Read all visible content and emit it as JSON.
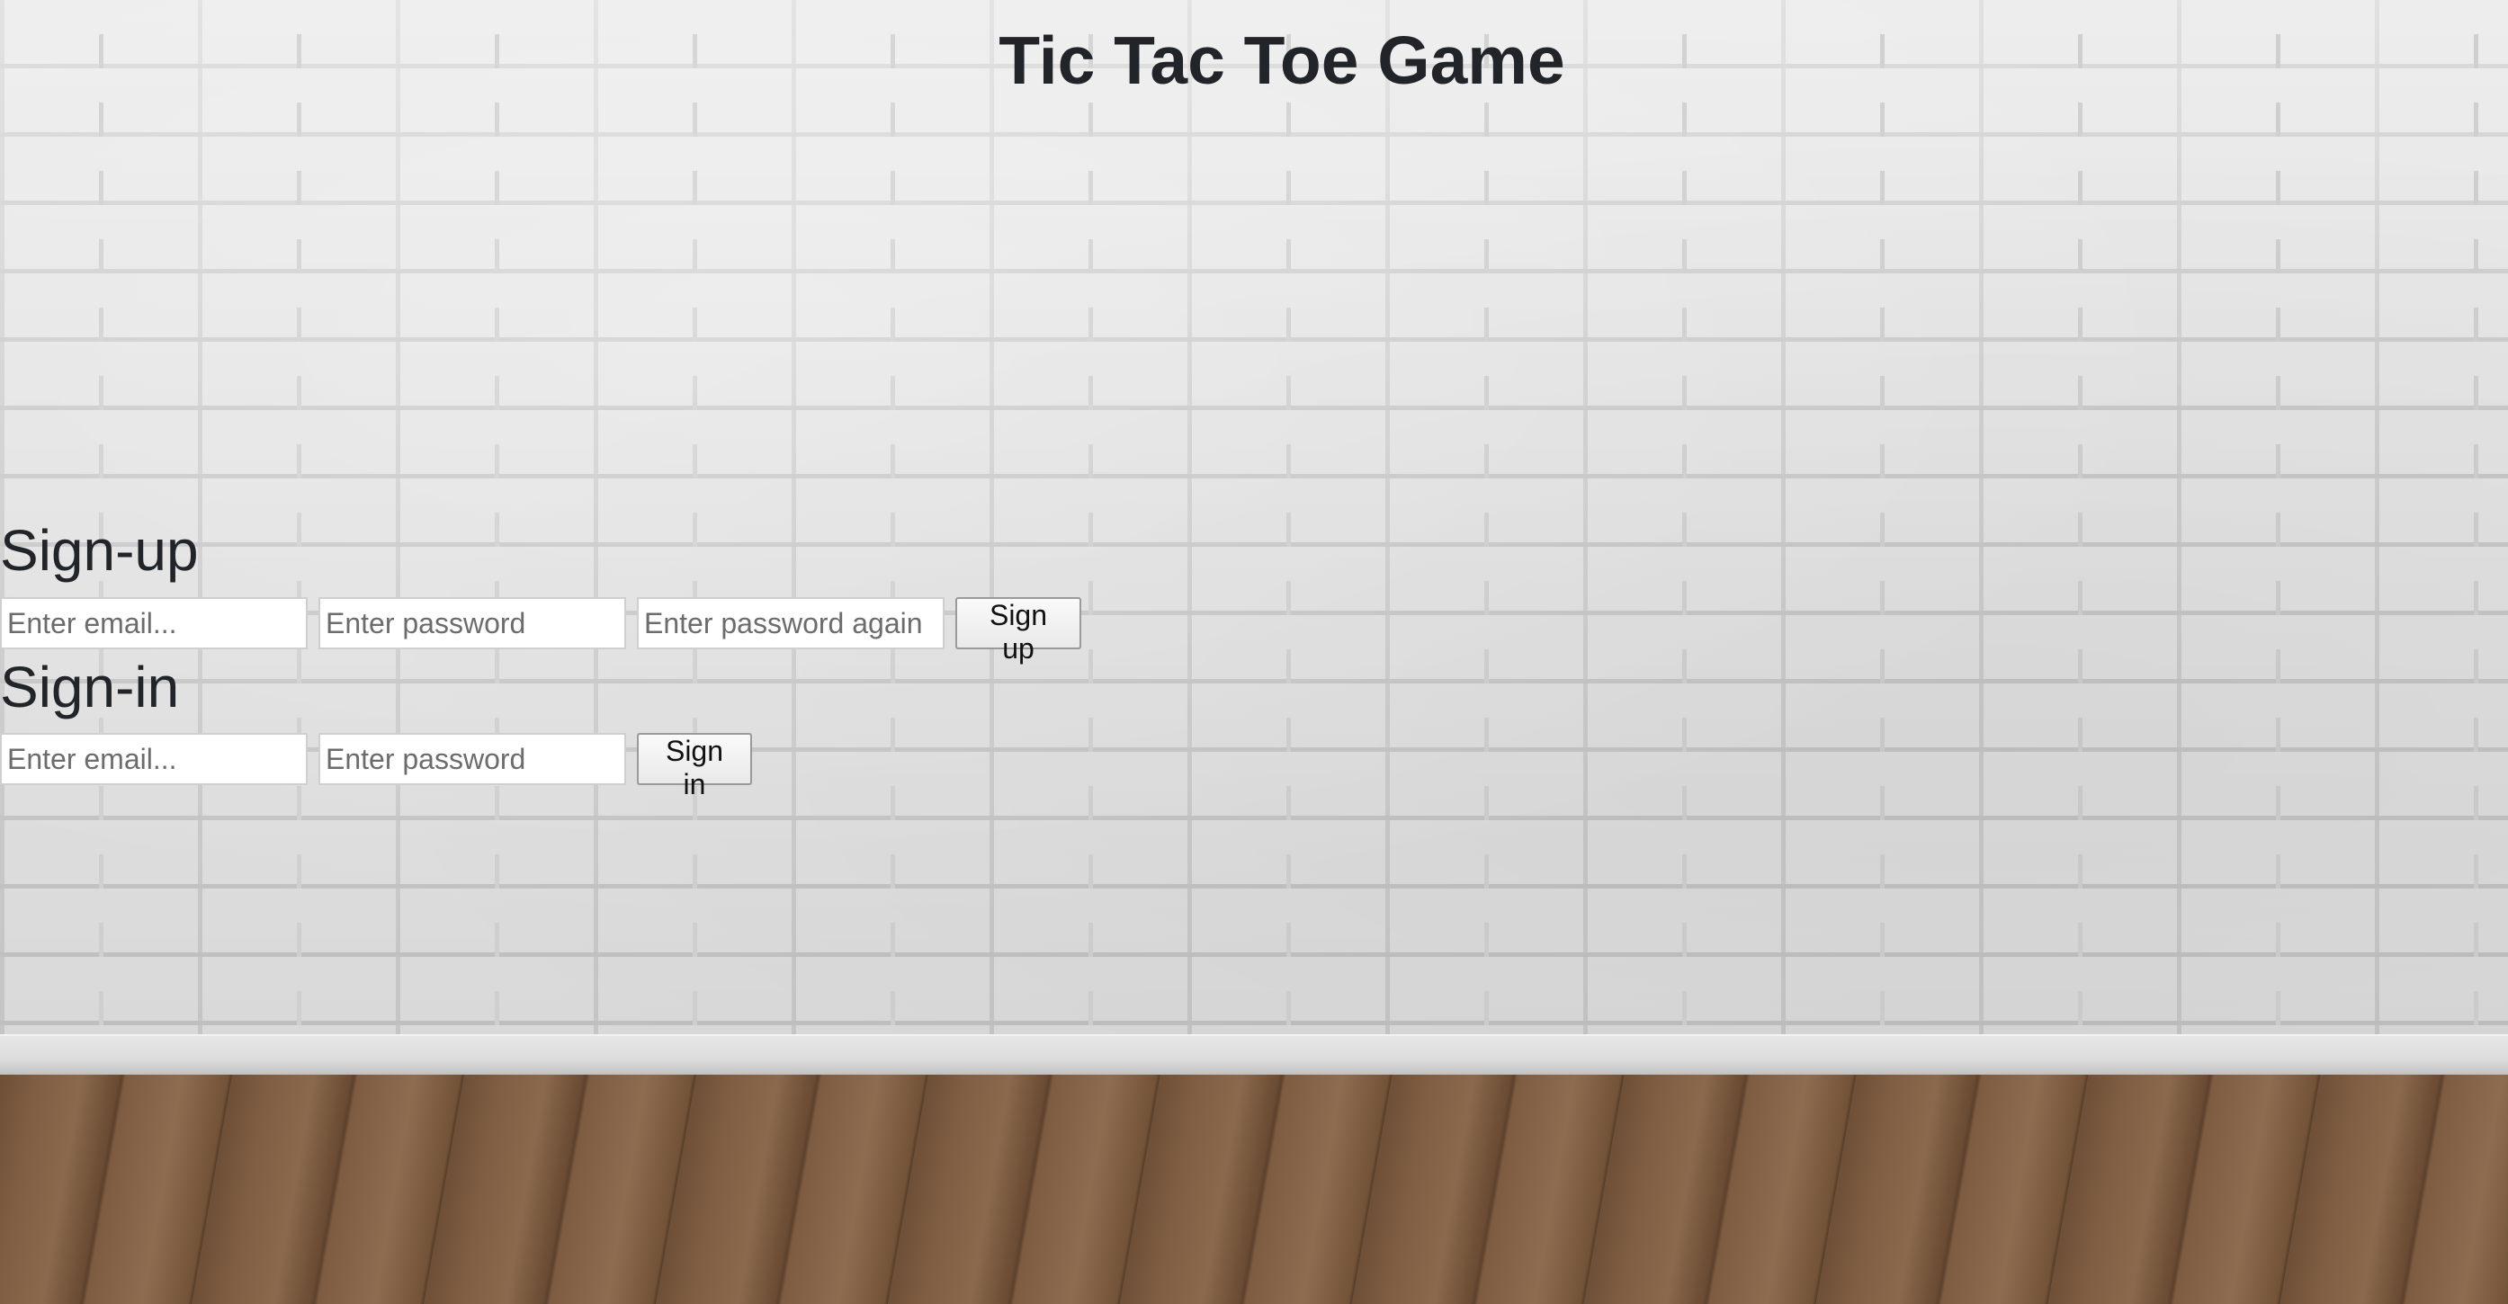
{
  "page": {
    "title": "Tic Tac Toe Game"
  },
  "signup": {
    "heading": "Sign-up",
    "email_placeholder": "Enter email...",
    "password_placeholder": "Enter password",
    "password_confirm_placeholder": "Enter password again",
    "button_label": "Sign up"
  },
  "signin": {
    "heading": "Sign-in",
    "email_placeholder": "Enter email...",
    "password_placeholder": "Enter password",
    "button_label": "Sign in"
  },
  "background": {
    "wall": "white-brick-wall",
    "floor": "wood-plank-floor"
  },
  "colors": {
    "text": "#212529",
    "wall": "#e4e4e4",
    "floor": "#7a5a40"
  }
}
